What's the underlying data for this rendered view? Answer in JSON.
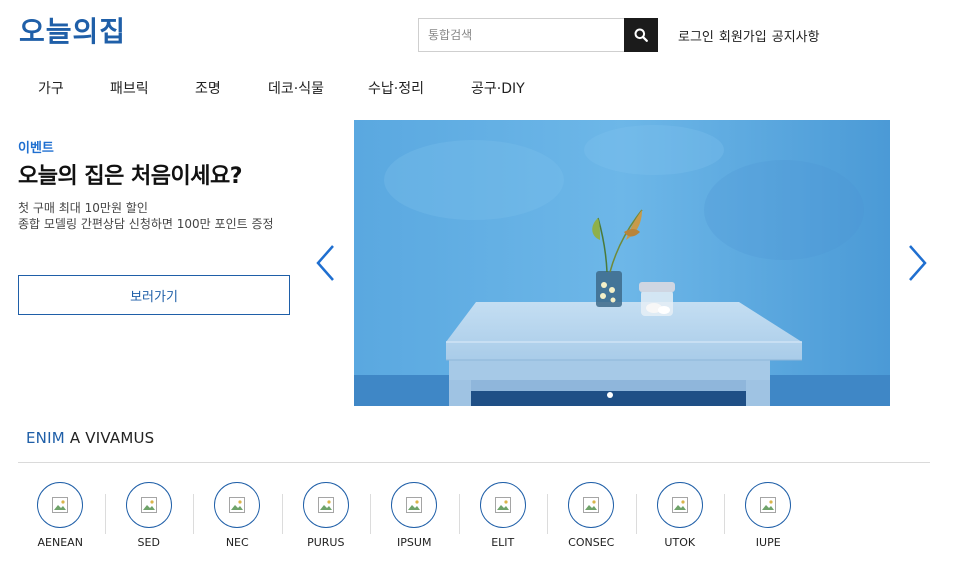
{
  "header": {
    "logo": "오늘의집",
    "search_placeholder": "통합검색",
    "links": [
      "로그인",
      "회원가입",
      "공지사항"
    ]
  },
  "category_nav": [
    {
      "label": "가구"
    },
    {
      "label": "패브릭"
    },
    {
      "label": "조명"
    },
    {
      "label": "데코·식물"
    },
    {
      "label": "수납·정리"
    },
    {
      "label": "공구·DIY"
    }
  ],
  "event": {
    "kicker": "이벤트",
    "title": "오늘의 집은 처음이세요?",
    "desc_line1": "첫 구매 최대 10만원 할인",
    "desc_line2": "종합 모델링 간편상담 신청하면 100만 포인트 증정",
    "button_label": "보러가기"
  },
  "carousel": {
    "slide_count": 1,
    "active_index": 0
  },
  "section": {
    "title_accent": "ENIM",
    "title_rest": "A VIVAMUS",
    "categories": [
      "AENEAN",
      "SED",
      "NEC",
      "PURUS",
      "IPSUM",
      "ELIT",
      "CONSEC",
      "UTOK",
      "IUPE"
    ]
  },
  "colors": {
    "brand": "#1f5fa8",
    "kicker": "#1f6fd0",
    "search_button": "#1b1b1b",
    "arrow": "#1f6fd0"
  },
  "icons": {
    "search": "search-icon",
    "prev": "chevron-left-icon",
    "next": "chevron-right-icon",
    "broken_image": "broken-image-icon"
  }
}
